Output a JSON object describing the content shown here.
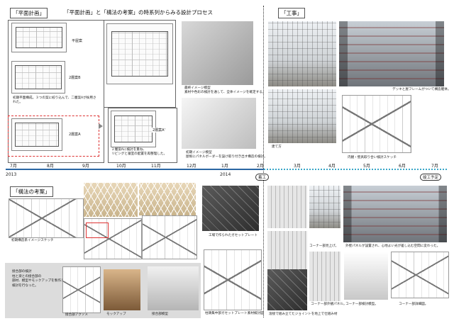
{
  "header": {
    "section_plan": "「平面計画」",
    "section_construction": "「工事」",
    "section_structure": "「構法の考案」",
    "main_title": "「平面計画」と「構法の考案」の時系列からみる設計プロセス"
  },
  "plan": {
    "labels": [
      "平屋案",
      "2層案B",
      "2層案A",
      "2層案A'"
    ],
    "caption_1": "初期平面構成。３つの案に絞り込んで、二層案Aが採用された。",
    "caption_2": "２層案Aに検討を重ね、\nリビングと寝室の配置を再整理した。"
  },
  "model": {
    "caption_top": "最終イメージ模型\n素材や色彩の検討を通して、全体イメージを確定する。",
    "caption_bottom": "初期イメージ模型\n屋根にパネルボーダーを設け取り付き出す構造の検討。"
  },
  "timeline": {
    "years": [
      "2013",
      "2014"
    ],
    "months_before": [
      "7月",
      "8月",
      "9月",
      "10月",
      "11月",
      "12月",
      "1月",
      "2月"
    ],
    "months_after": [
      "3月",
      "4月",
      "5月",
      "6月",
      "7月"
    ],
    "start_badge": "着工",
    "end_badge": "竣工予定"
  },
  "construction": {
    "caption_deck": "デッキと屋フレームがついて構造躯体。",
    "caption_frame": "建て方",
    "caption_sketch": "内観・壁具取り合い検討スケッチ",
    "caption_corner_1": "コーナー部見上げ。",
    "caption_panel": "外壁パネルが設置され、心地よい光が差し込む空間に変わった。",
    "caption_corner_2": "コーナー部外観パネル。",
    "caption_corner_3": "コーナー部検討模型。",
    "caption_corner_4": "コーナー部詳細図。",
    "caption_joint": "溶接で組み立てたジョイントを地上で仕組み材"
  },
  "structure": {
    "caption_sketch": "初期構造系イメージスケッチ",
    "caption_plate": "工場で作られたガセットプレート",
    "caption_pattern": "柱頭集中部ガセットプレート素材検討図",
    "note": "接合部の検討\n柱と梁との接合部の\n部材、模型やモックアップを製作しながら\n検討を行なった。",
    "caption_axon": "接合部アクソメ",
    "caption_mockup": "モックアップ",
    "caption_model": "接合部模型"
  }
}
